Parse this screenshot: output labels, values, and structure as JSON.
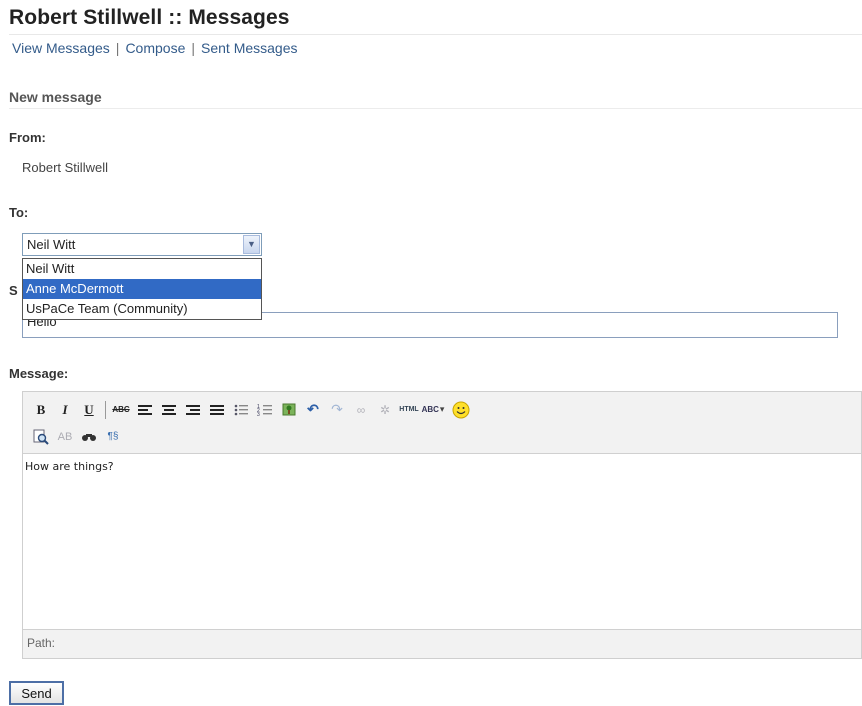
{
  "header": {
    "title": "Robert Stillwell :: Messages"
  },
  "nav": [
    {
      "label": "View Messages"
    },
    {
      "label": "Compose"
    },
    {
      "label": "Sent Messages"
    }
  ],
  "form": {
    "section_title": "New message",
    "from_label": "From:",
    "from_value": "Robert Stillwell",
    "to_label": "To:",
    "to_selected": "Neil Witt",
    "to_options": [
      "Neil Witt",
      "Anne McDermott",
      "UsPaCe Team (Community)"
    ],
    "to_highlighted": "Anne McDermott",
    "subject_label_partial": "S",
    "subject_value": "Hello",
    "message_label": "Message:"
  },
  "editor": {
    "toolbar_row1": [
      "bold-icon",
      "italic-icon",
      "underline-icon",
      "strikethrough-icon",
      "align-left-icon",
      "align-center-icon",
      "align-right-icon",
      "align-justify-icon",
      "bullet-list-icon",
      "numbered-list-icon",
      "image-icon",
      "undo-icon",
      "redo-icon",
      "link-icon",
      "unlink-icon",
      "html-icon",
      "spellcheck-icon",
      "emoticon-icon"
    ],
    "toolbar_row2": [
      "find-icon",
      "replace-icon",
      "search-icon",
      "visual-aid-icon"
    ],
    "body_text": "How are things?",
    "status_label": "Path:"
  },
  "actions": {
    "send_label": "Send"
  }
}
